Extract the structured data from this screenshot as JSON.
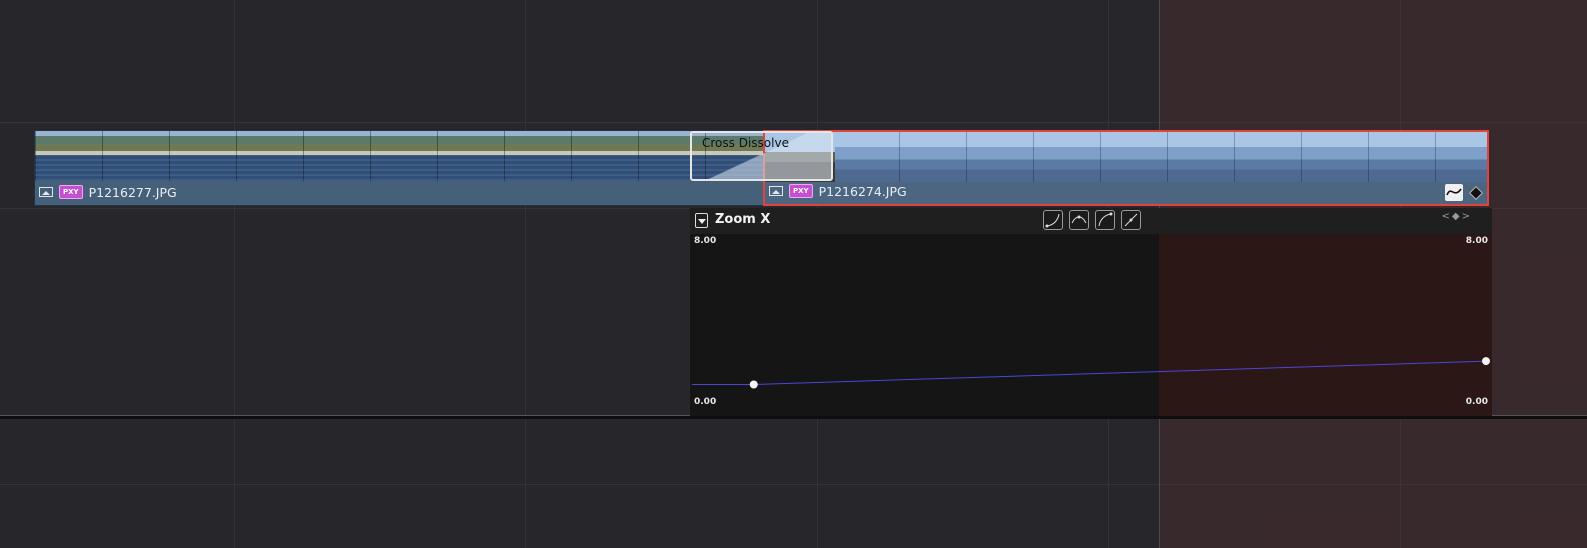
{
  "timeline": {
    "clips": [
      {
        "name": "P1216277.JPG",
        "badge": "PXY",
        "media_icon": "image-icon"
      },
      {
        "name": "P1216274.JPG",
        "badge": "PXY",
        "media_icon": "image-icon",
        "selected": true
      }
    ],
    "transition": {
      "label": "Cross Dissolve"
    },
    "icons": {
      "curve_toggle": "curve-editor-icon",
      "keyframe": "keyframe-diamond-icon"
    }
  },
  "curve_editor": {
    "title": "Zoom X",
    "max_label": "8.00",
    "min_label": "0.00",
    "interpolation_buttons": [
      "ease-in-icon",
      "ease-both-icon",
      "ease-out-icon",
      "linear-icon"
    ],
    "nav_icons": [
      "prev-keyframe-icon",
      "add-keyframe-icon",
      "next-keyframe-icon"
    ],
    "keyframes": [
      {
        "position": 0.08,
        "value": 1.0
      },
      {
        "position": 1.0,
        "value": 2.2
      }
    ],
    "curve_color": "#4b46d6"
  },
  "colors": {
    "selection": "#e2443c",
    "pxy_badge": "#c44fd0"
  }
}
